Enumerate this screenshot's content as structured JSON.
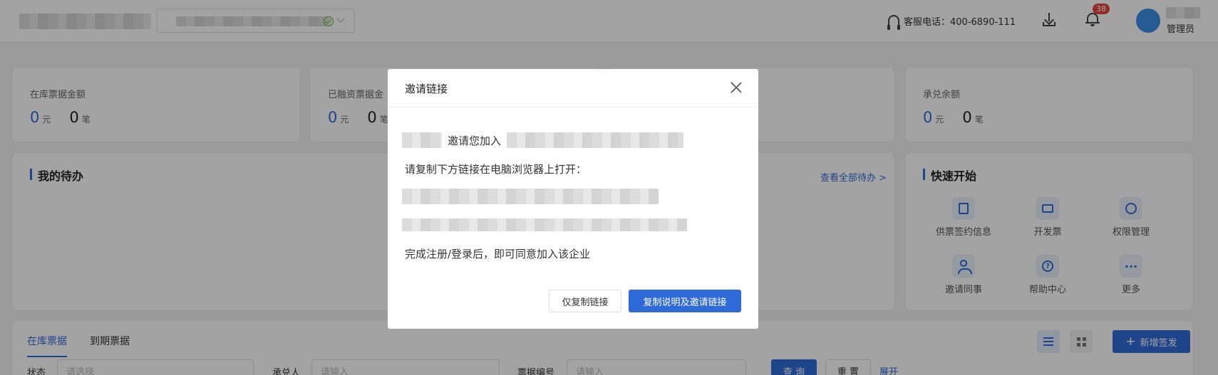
{
  "header": {
    "service_label": "客服电话：400-6890-111",
    "notification_count": "38",
    "role": "管理员"
  },
  "stats": [
    {
      "label": "在库票据金额",
      "amount": "0",
      "amount_unit": "元",
      "count": "0",
      "count_unit": "笔"
    },
    {
      "label": "已融资票据金",
      "amount": "0",
      "amount_unit": "元",
      "count": "0",
      "count_unit": "笔"
    },
    {
      "label": "承兑余额",
      "amount": "0",
      "amount_unit": "元",
      "count": "0",
      "count_unit": "笔"
    }
  ],
  "todo": {
    "title": "我的待办",
    "view_all": "查看全部待办 >"
  },
  "quick_start": {
    "title": "快速开始",
    "items": [
      {
        "label": "供票签约信息",
        "icon": "document-edit-icon"
      },
      {
        "label": "开发票",
        "icon": "invoice-icon"
      },
      {
        "label": "权限管理",
        "icon": "gear-icon"
      },
      {
        "label": "邀请同事",
        "icon": "invite-user-icon"
      },
      {
        "label": "帮助中心",
        "icon": "help-icon"
      },
      {
        "label": "更多",
        "icon": "more-icon"
      }
    ]
  },
  "bills": {
    "tabs": [
      "在库票据",
      "到期票据"
    ],
    "new_button": "新增签发",
    "filters": [
      {
        "label": "状态",
        "placeholder": "请选择"
      },
      {
        "label": "承兑人",
        "placeholder": "请输入"
      },
      {
        "label": "票据编号",
        "placeholder": "请输入"
      }
    ],
    "query_button": "查 询",
    "reset_button": "重 置",
    "expand_link": "展开"
  },
  "dialog": {
    "title": "邀请链接",
    "invite_text": "邀请您加入",
    "instruction": "请复制下方链接在电脑浏览器上打开：",
    "footer_note": "完成注册/登录后，即可同意加入该企业",
    "copy_link_button": "仅复制链接",
    "copy_all_button": "复制说明及邀请链接"
  },
  "colors": {
    "primary": "#2f6bd8",
    "badge": "#e8423c",
    "success": "#52c41a"
  }
}
